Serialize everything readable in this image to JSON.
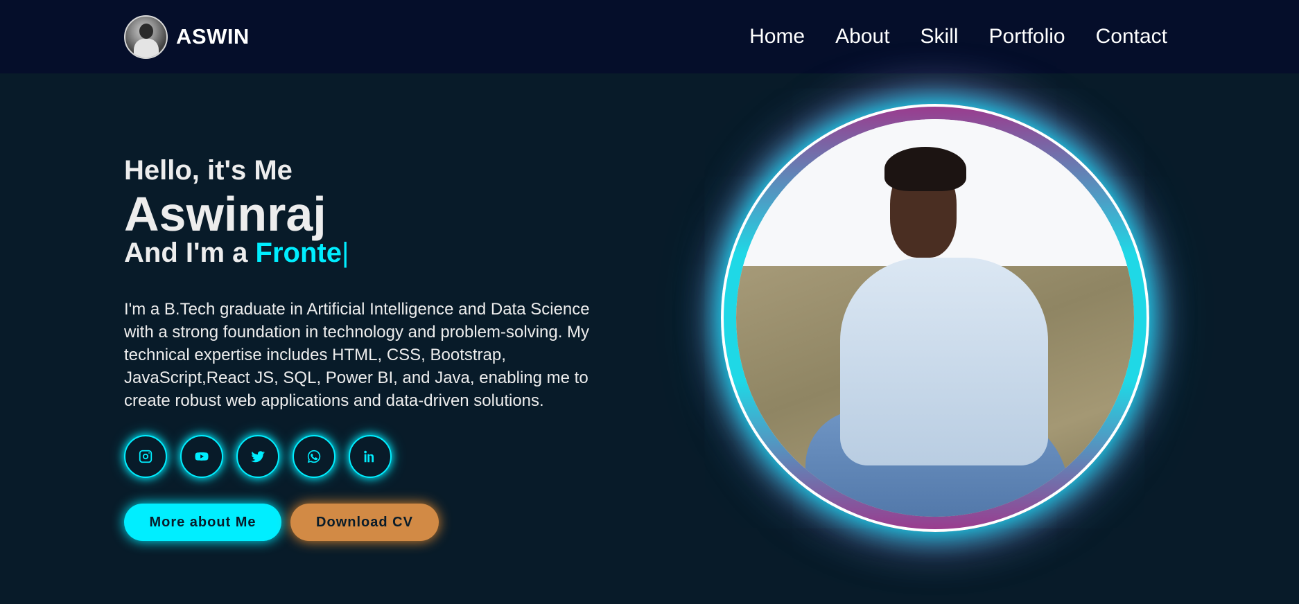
{
  "header": {
    "brand": "ASWIN",
    "nav": [
      "Home",
      "About",
      "Skill",
      "Portfolio",
      "Contact"
    ]
  },
  "hero": {
    "greeting": "Hello, it's Me",
    "name": "Aswinraj",
    "role_prefix": "And I'm a ",
    "role_typed": "Fronte",
    "cursor": "|",
    "bio": "I'm a B.Tech graduate in Artificial Intelligence and Data Science with a strong foundation in technology and problem-solving. My technical expertise includes HTML, CSS, Bootstrap, JavaScript,React JS, SQL, Power BI, and Java, enabling me to create robust web applications and data-driven solutions."
  },
  "socials": [
    "instagram-icon",
    "youtube-icon",
    "twitter-icon",
    "whatsapp-icon",
    "linkedin-icon"
  ],
  "buttons": {
    "more": "More about Me",
    "cv": "Download CV"
  },
  "colors": {
    "background": "#081b29",
    "header": "#050e2a",
    "accent": "#00eeff",
    "cv_button": "#d28a45",
    "ring_pink": "#9a3c8e"
  }
}
